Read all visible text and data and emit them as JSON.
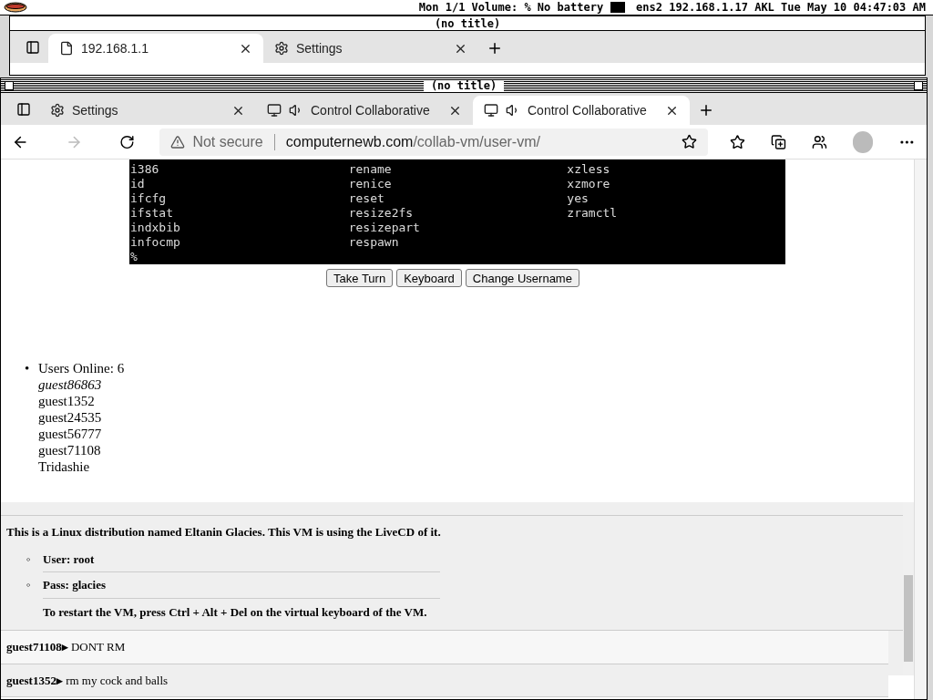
{
  "menubar": {
    "status": "Mon 1/1 Volume: % No battery",
    "network": "ens2 192.168.1.17 AKL Tue May 10 04:47:03 AM"
  },
  "outer_window": {
    "title": "(no title)",
    "tabs": [
      {
        "label": "192.168.1.1",
        "kind": "page",
        "selected": true
      },
      {
        "label": "Settings",
        "kind": "settings",
        "selected": false
      }
    ]
  },
  "inner_window": {
    "title": "(no title)",
    "tabs": [
      {
        "label": "Settings",
        "kind": "settings",
        "selected": false
      },
      {
        "label": "Control Collaborative",
        "kind": "vm",
        "selected": false
      },
      {
        "label": "Control Collaborative",
        "kind": "vm",
        "selected": true
      }
    ],
    "address": {
      "security": "Not secure",
      "host": "computernewb.com",
      "path": "/collab-vm/user-vm/"
    }
  },
  "terminal": {
    "rows": [
      [
        "i386",
        "rename",
        "xzless"
      ],
      [
        "id",
        "renice",
        "xzmore"
      ],
      [
        "ifcfg",
        "reset",
        "yes"
      ],
      [
        "ifstat",
        "resize2fs",
        "zramctl"
      ],
      [
        "indxbib",
        "resizepart",
        ""
      ],
      [
        "infocmp",
        "respawn",
        ""
      ]
    ],
    "prompt": "%"
  },
  "buttons": [
    "Take Turn",
    "Keyboard",
    "Change Username"
  ],
  "users": {
    "marker": "•",
    "header": "Users Online: 6",
    "list": [
      {
        "name": "guest86863",
        "self": true
      },
      {
        "name": "guest1352",
        "self": false
      },
      {
        "name": "guest24535",
        "self": false
      },
      {
        "name": "guest56777",
        "self": false
      },
      {
        "name": "guest71108",
        "self": false
      },
      {
        "name": "Tridashie",
        "self": false
      }
    ]
  },
  "chat": {
    "messages": [
      {
        "kind": "motd",
        "text": "This is a Linux distribution named Eltanin Glacies. This VM is using the LiveCD of it.",
        "item_marker": "◦",
        "items": [
          "User: root",
          "Pass: glacies"
        ],
        "note": "To restart the VM, press Ctrl + Alt + Del on the virtual keyboard of the VM."
      },
      {
        "kind": "message",
        "user": "guest71108",
        "marker": "▸",
        "text": "DONT RM"
      },
      {
        "kind": "message",
        "user": "guest1352",
        "marker": "▸",
        "text": "rm my cock and balls"
      }
    ]
  }
}
